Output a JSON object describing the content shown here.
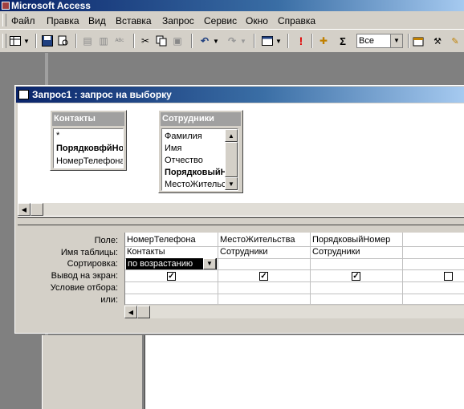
{
  "app": {
    "title": "Microsoft Access"
  },
  "menu": {
    "items": [
      "Файл",
      "Правка",
      "Вид",
      "Вставка",
      "Запрос",
      "Сервис",
      "Окно",
      "Справка"
    ]
  },
  "toolbar": {
    "top_values": {
      "value": "Все"
    },
    "icons": [
      "view-icon",
      "save-icon",
      "search-icon",
      "print-icon",
      "print-preview-icon",
      "spelling-icon",
      "cut-icon",
      "copy-icon",
      "paste-icon",
      "undo-icon",
      "redo-icon",
      "query-type-icon",
      "run-icon",
      "show-table-icon",
      "totals-icon",
      "properties-icon",
      "build-icon"
    ]
  },
  "query_window": {
    "title": "Запрос1 : запрос на выборку",
    "tables": [
      {
        "name": "Контакты",
        "fields": [
          "*",
          "ПорядковфйНомер",
          "НомерТелефона"
        ],
        "bold": [
          false,
          true,
          false
        ]
      },
      {
        "name": "Сотрудники",
        "fields": [
          "Фамилия",
          "Имя",
          "Отчество",
          "ПорядковыйНомер",
          "МестоЖительства"
        ],
        "bold": [
          false,
          false,
          false,
          true,
          false
        ]
      }
    ]
  },
  "grid": {
    "row_labels": [
      "Поле:",
      "Имя таблицы:",
      "Сортировка:",
      "Вывод на экран:",
      "Условие отбора:",
      "или:"
    ],
    "columns": [
      {
        "field": "НомерТелефона",
        "table": "Контакты",
        "sort": "по возрастанию",
        "show": true
      },
      {
        "field": "МестоЖительства",
        "table": "Сотрудники",
        "sort": "",
        "show": true
      },
      {
        "field": "ПорядковыйНомер",
        "table": "Сотрудники",
        "sort": "",
        "show": true
      },
      {
        "field": "",
        "table": "",
        "sort": "",
        "show": false
      }
    ]
  },
  "colors": {
    "title_active": "#0a246a",
    "face": "#d4d0c8",
    "mdi_bg": "#808080"
  }
}
